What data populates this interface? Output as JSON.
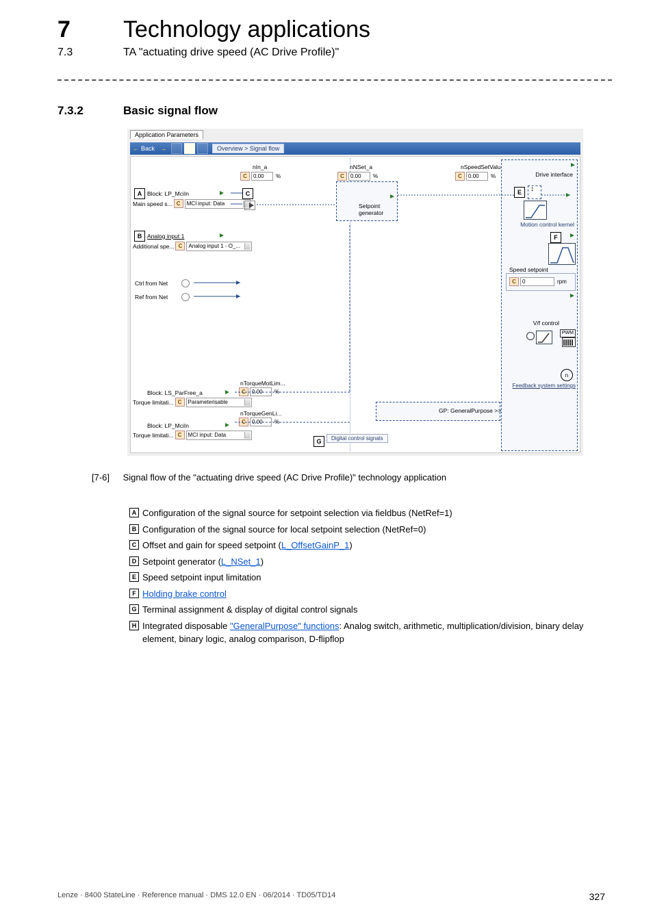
{
  "header": {
    "chapnum": "7",
    "chaptitle": "Technology applications",
    "secnum": "7.3",
    "sectitle": "TA \"actuating drive speed (AC Drive Profile)\"",
    "subsecnum": "7.3.2",
    "subsectitle": "Basic signal flow"
  },
  "diagram": {
    "tab": "Application Parameters",
    "back": "Back",
    "crumb": "Overview > Signal flow",
    "labels": {
      "nIn_a": "nIn_a",
      "nNSet_a": "nNSet_a",
      "nSpeedSetValu": "nSpeedSetValu...",
      "DriveInterface": "Drive interface",
      "SetpointGen": "Setpoint\ngenerator",
      "MotionCtrl": "Motion control kernel",
      "SpeedSetpoint": "Speed setpoint",
      "rpm": "rpm",
      "Vfcontrol": "V/f control",
      "PWM": "PWM",
      "nTorqueMotLim": "nTorqueMotLim...",
      "nTorqueGenLi": "nTorqueGenLi...",
      "GP": "GP: GeneralPurpose >>",
      "FeedbackSys": "Feedback system settings",
      "DigitalCtrlSig": "Digital control signals"
    },
    "blocks": {
      "A": {
        "title": "Block: LP_MciIn",
        "sub": "Main speed s...",
        "drop": "MCI input: Data"
      },
      "B": {
        "title": "Analog input 1",
        "sub": "Additional spe...",
        "drop": "Analog input 1 - O_..."
      },
      "CtrlFromNet": "Ctrl from Net",
      "RefFromNet": "Ref from Net",
      "ParFree": {
        "title": "Block: LS_ParFree_a",
        "sub": "Torque limitati...",
        "drop": "Parameterisable"
      },
      "Mci2": {
        "title": "Block: LP_MciIn",
        "sub": "Torque limitati...",
        "drop": "MCI input: Data"
      }
    },
    "vals": {
      "zero": "0.00",
      "zeroInt": "0"
    }
  },
  "caption": {
    "id": "[7-6]",
    "text": "Signal flow of the \"actuating drive speed (AC Drive Profile)\" technology application"
  },
  "legend": {
    "A": "Configuration of the signal source for setpoint selection via fieldbus (NetRef=1)",
    "B": "Configuration of the signal source for local setpoint selection (NetRef=0)",
    "C_pre": "Offset and gain for speed setpoint (",
    "C_link": "L_OffsetGainP_1",
    "C_post": ")",
    "D_pre": "Setpoint generator (",
    "D_link": "L_NSet_1",
    "D_post": ")",
    "E": "Speed setpoint input limitation",
    "F": "Holding brake control",
    "G": "Terminal assignment & display of digital control signals",
    "H_pre": "Integrated disposable ",
    "H_link": "\"GeneralPurpose\" functions",
    "H_post": ": Analog switch, arithmetic, multiplication/division, binary delay element, binary logic, analog comparison, D-flipflop"
  },
  "footer": {
    "line": "Lenze · 8400 StateLine · Reference manual · DMS 12.0 EN · 06/2014 · TD05/TD14",
    "page": "327"
  }
}
